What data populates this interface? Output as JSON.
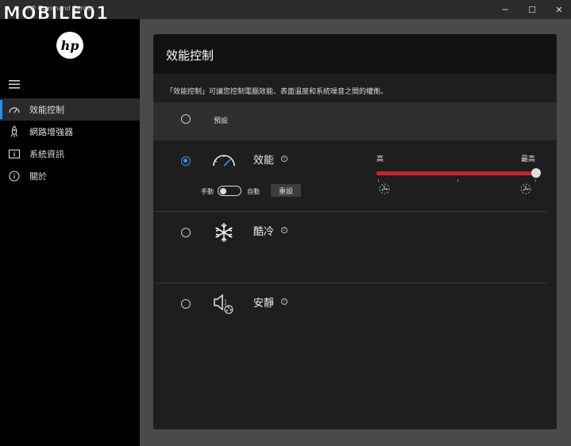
{
  "window": {
    "title": "HP Command Center",
    "watermark": "MOBILE01",
    "minimize": "─",
    "maximize": "☐",
    "close": "✕"
  },
  "sidebar": {
    "logo": "hp",
    "items": [
      {
        "label": "效能控制",
        "icon": "speedometer-icon",
        "active": true
      },
      {
        "label": "網路增強器",
        "icon": "rocket-icon"
      },
      {
        "label": "系統資訊",
        "icon": "info-box-icon"
      },
      {
        "label": "關於",
        "icon": "info-circle-icon"
      }
    ]
  },
  "panel": {
    "title": "效能控制",
    "description": "「效能控制」可讓您控制電腦效能、表面溫度和系統噪音之間的權衡。",
    "default_label": "預設",
    "performance": {
      "label": "效能",
      "info": "i",
      "manual_label": "手動",
      "auto_label": "自動",
      "reset_label": "重設",
      "slider_low": "高",
      "slider_high": "最高",
      "slider_value": 1.0
    },
    "cool_label": "酷冷",
    "quiet_label": "安靜",
    "selected": "performance"
  },
  "colors": {
    "accent": "#3d8ee6",
    "slider": "#c0262c"
  }
}
